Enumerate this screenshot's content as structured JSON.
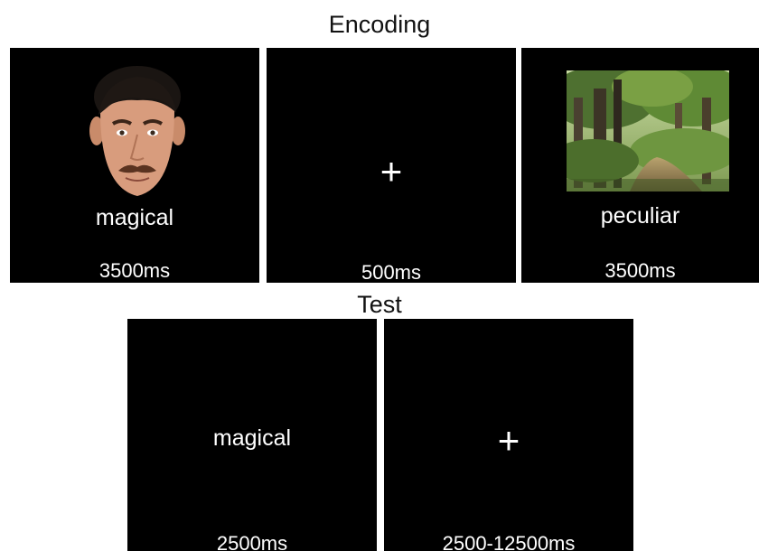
{
  "encoding": {
    "title": "Encoding",
    "panels": [
      {
        "type": "face-word",
        "word": "magical",
        "duration": "3500ms"
      },
      {
        "type": "fixation",
        "symbol": "+",
        "duration": "500ms"
      },
      {
        "type": "scene-word",
        "word": "peculiar",
        "duration": "3500ms"
      }
    ]
  },
  "test": {
    "title": "Test",
    "panels": [
      {
        "type": "word",
        "word": "magical",
        "duration": "2500ms"
      },
      {
        "type": "fixation",
        "symbol": "+",
        "duration": "2500-12500ms"
      }
    ]
  },
  "colors": {
    "panel_bg": "#000000",
    "panel_text": "#ffffff",
    "title_text": "#111111"
  }
}
